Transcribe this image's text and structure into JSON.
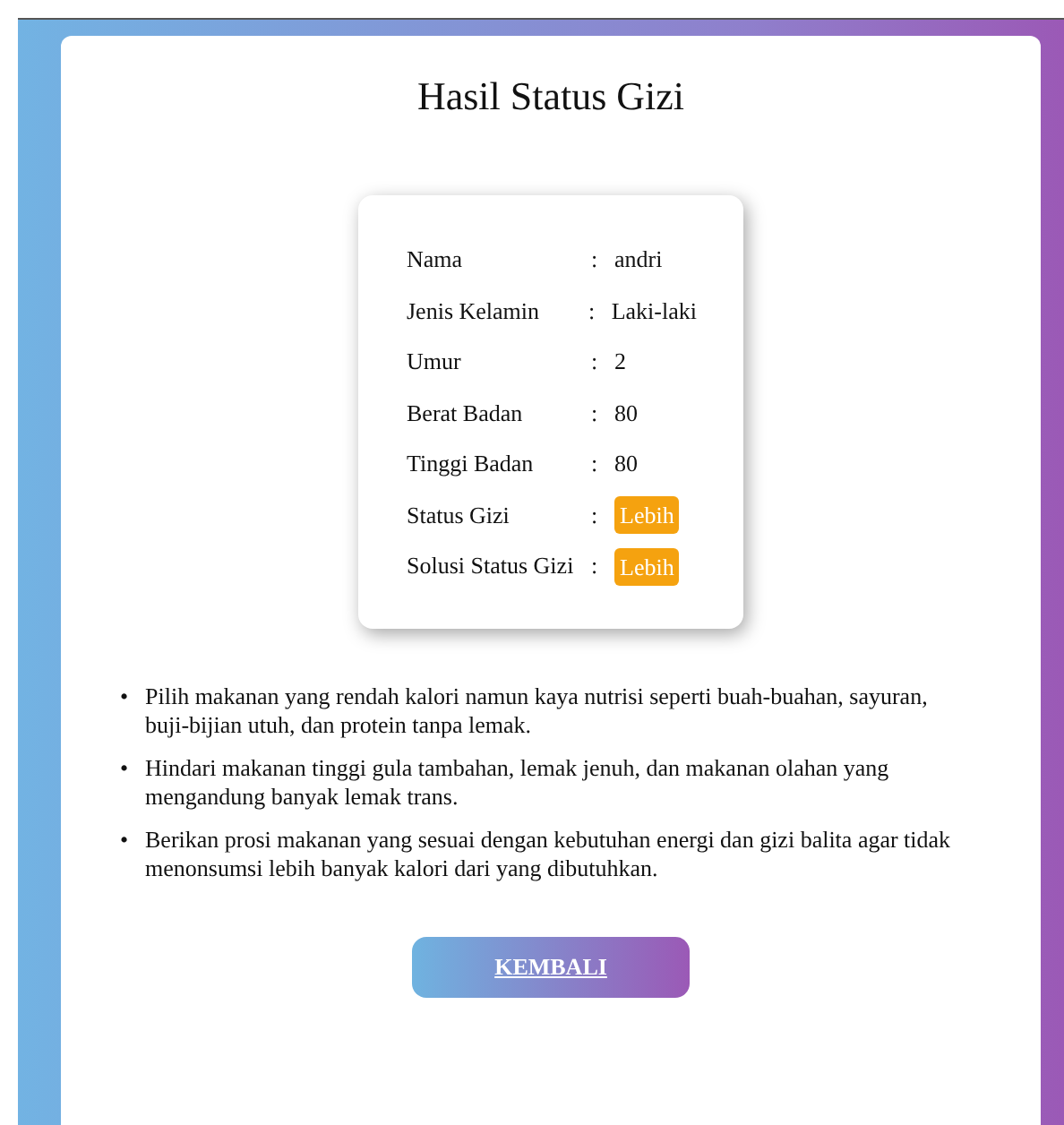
{
  "title": "Hasil Status Gizi",
  "details": [
    {
      "label": "Nama",
      "separator": ":",
      "value": "andri",
      "kind": "text"
    },
    {
      "label": "Jenis Kelamin",
      "separator": ":",
      "value": "Laki-laki",
      "kind": "text"
    },
    {
      "label": "Umur",
      "separator": ":",
      "value": "2",
      "kind": "text"
    },
    {
      "label": "Berat Badan",
      "separator": ":",
      "value": "80",
      "kind": "text"
    },
    {
      "label": "Tinggi Badan",
      "separator": ":",
      "value": "80",
      "kind": "text"
    },
    {
      "label": "Status Gizi",
      "separator": ":",
      "value": "Lebih",
      "kind": "badge"
    },
    {
      "label": "Solusi Status Gizi",
      "separator": ":",
      "value": "Lebih",
      "kind": "badge"
    }
  ],
  "advice": [
    {
      "bullet": "•",
      "text": "Pilih makanan yang rendah kalori namun kaya nutrisi seperti buah-buahan, sayuran, buji-bijian utuh, dan protein tanpa lemak."
    },
    {
      "bullet": "•",
      "text": "Hindari makanan tinggi gula tambahan, lemak jenuh, dan makanan olahan yang mengandung banyak lemak trans."
    },
    {
      "bullet": "•",
      "text": "Berikan prosi makanan yang sesuai dengan kebutuhan energi dan gizi balita agar tidak menonsumsi lebih banyak kalori dari yang dibutuhkan."
    }
  ],
  "back_button": "KEMBALI"
}
